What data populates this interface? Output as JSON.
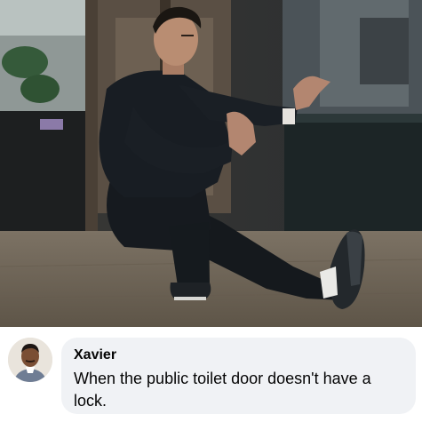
{
  "post": {
    "image": {
      "subject": "man in black kung fu outfit crouching low in a martial-arts stance, one leg extended to the side",
      "palette": {
        "floor": "#6f6557",
        "wall": "#2b2d2e",
        "outfit": "#171b20",
        "skin": "#b88b70"
      }
    },
    "comment": {
      "author": "Xavier",
      "text": "When the public toilet door doesn't have a lock.",
      "avatar_icon": "profile-photo-icon"
    }
  }
}
